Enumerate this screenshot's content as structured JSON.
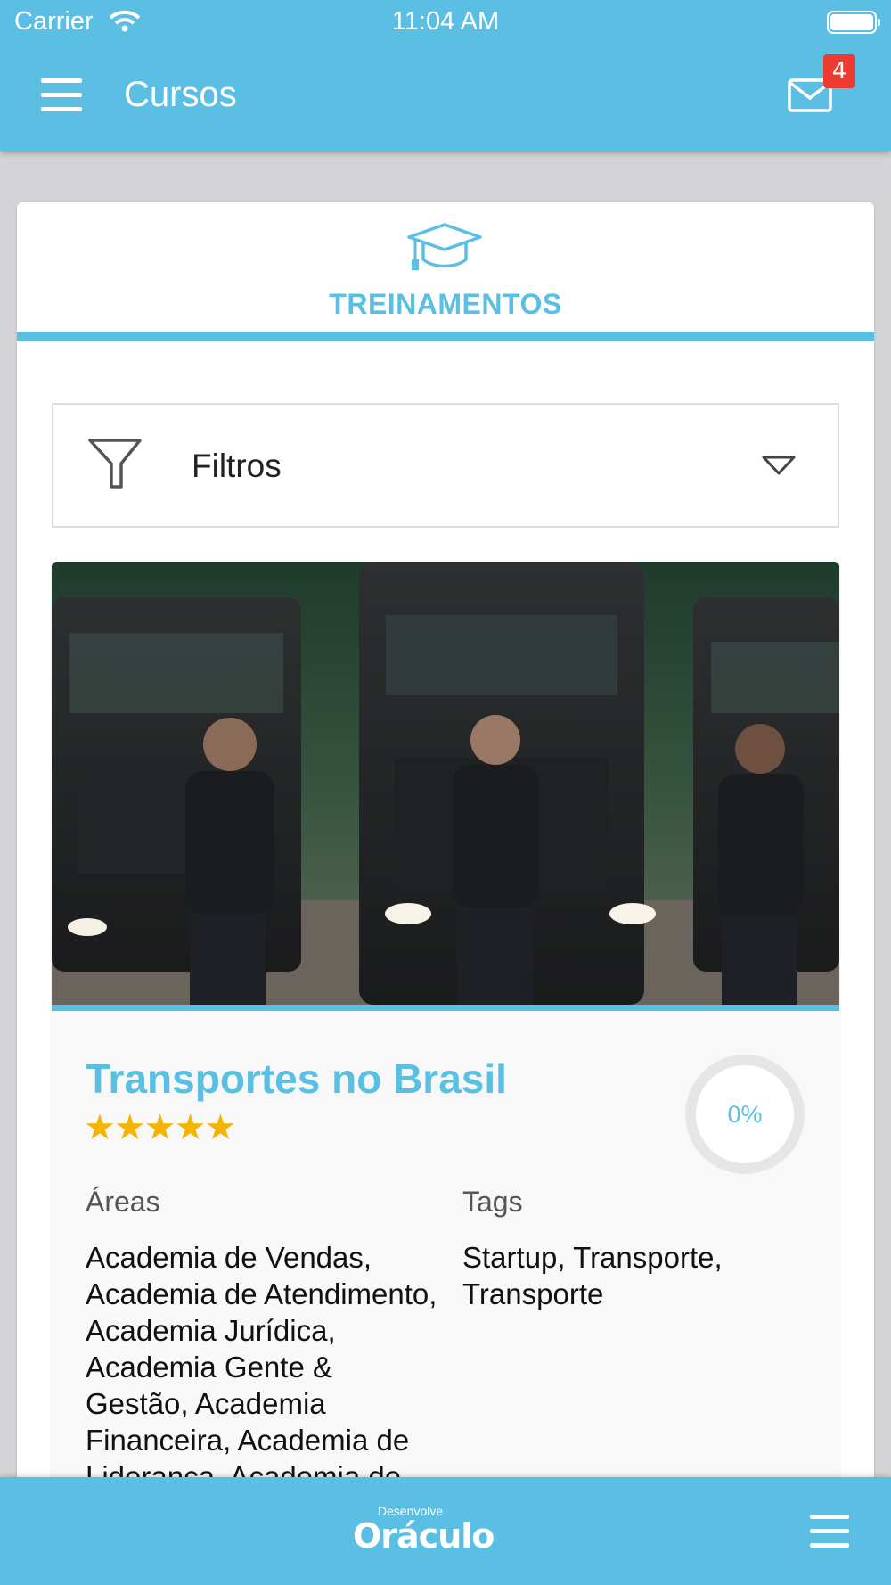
{
  "status_bar": {
    "carrier": "Carrier",
    "time": "11:04 AM"
  },
  "app_bar": {
    "title": "Cursos",
    "mail_badge": "4"
  },
  "tab": {
    "label": "TREINAMENTOS",
    "icon": "graduation-cap-icon"
  },
  "filter": {
    "label": "Filtros"
  },
  "course": {
    "title": "Transportes no Brasil",
    "rating": 5,
    "rating_display": "★★★★★",
    "progress": "0%",
    "progress_value": 0,
    "areas_label": "Áreas",
    "areas_value": "Academia de Vendas, Academia de Atendimento, Academia Jurídica, Academia Gente & Gestão, Academia Financeira, Academia de Liderança, Academia de",
    "tags_label": "Tags",
    "tags_value": "Startup, Transporte, Transporte"
  },
  "bottom_bar": {
    "logo_small": "Desenvolve",
    "logo_big": "Oráculo"
  },
  "colors": {
    "primary": "#5bbfe3",
    "badge": "#ee3b32",
    "star": "#f5b400",
    "background": "#d4d3d5"
  }
}
